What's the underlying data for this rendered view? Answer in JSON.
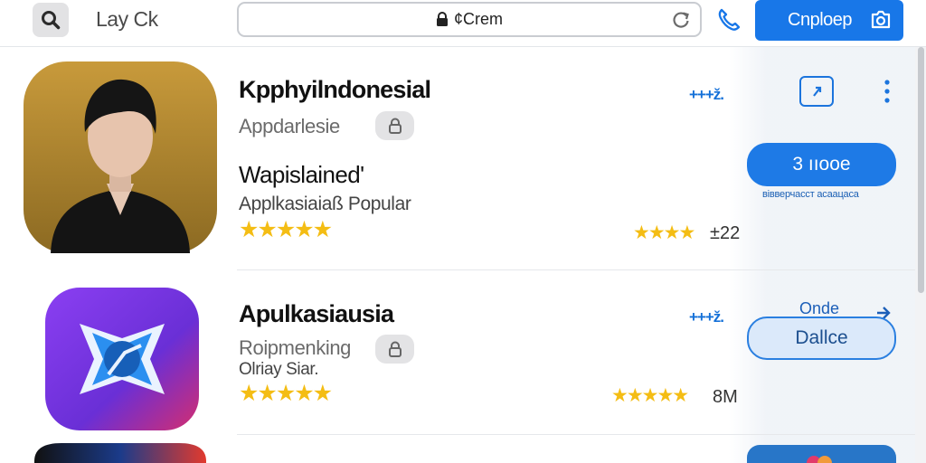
{
  "header": {
    "title": "Lay Ck",
    "url": "¢Crem",
    "primary_button": "Cnploep"
  },
  "apps": [
    {
      "name": "Kpphyilndonesial",
      "subtitle": "Appdarlesie",
      "mini_rating": "+++ž.",
      "tagline": "Wapislained'",
      "category": "Applkasiaiaß Popular",
      "stars": "★★★★★",
      "stars_small": "★★★★",
      "rating_count": "±22",
      "action_button": "3 ııooe",
      "caption": "вівверчасст асаацаса"
    },
    {
      "name": "Apulkasiausia",
      "subtitle": "Roipmenking",
      "line2": "Olriay Siar.",
      "mini_rating": "+++ž.",
      "stars": "★★★★★",
      "stars_small": "★★★★★",
      "rating_count": "8M",
      "link_label": "Onde",
      "action_button": "Dallce"
    }
  ],
  "colors": {
    "accent": "#1877e8",
    "star": "#f4bd14"
  }
}
